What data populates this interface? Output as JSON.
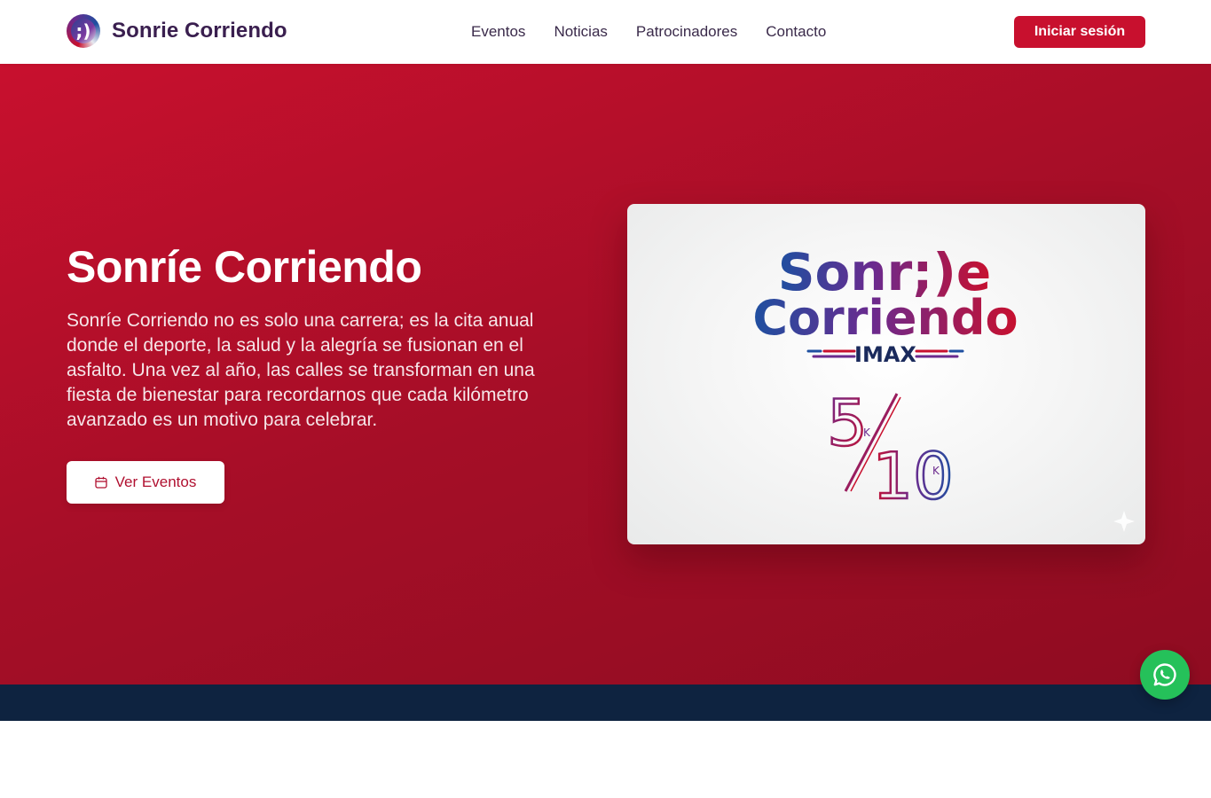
{
  "header": {
    "brand_name": "Sonrie Corriendo",
    "nav": [
      "Eventos",
      "Noticias",
      "Patrocinadores",
      "Contacto"
    ],
    "login_label": "Iniciar sesión"
  },
  "hero": {
    "title": "Sonríe Corriendo",
    "description": "Sonríe Corriendo no es solo una carrera; es la cita anual donde el deporte, la salud y la alegría se fusionan en el asfalto. Una vez al año, las calles se transforman en una fiesta de bienestar para recordarnos que cada kilómetro avanzado es un motivo para celebrar.",
    "cta_label": "Ver Eventos",
    "cta_icon": "calendar-icon",
    "image": {
      "line1": "Sonr;)e",
      "line2": "Corriendo",
      "sponsor": "IMAX",
      "distance_top": "5",
      "distance_bottom": "10",
      "unit": "K"
    }
  },
  "floating": {
    "icon": "whatsapp-icon"
  },
  "colors": {
    "brand_red": "#c8102e",
    "dark_navy": "#0e2340",
    "whatsapp_green": "#25c15a",
    "brand_purple": "#3a1f4f"
  }
}
